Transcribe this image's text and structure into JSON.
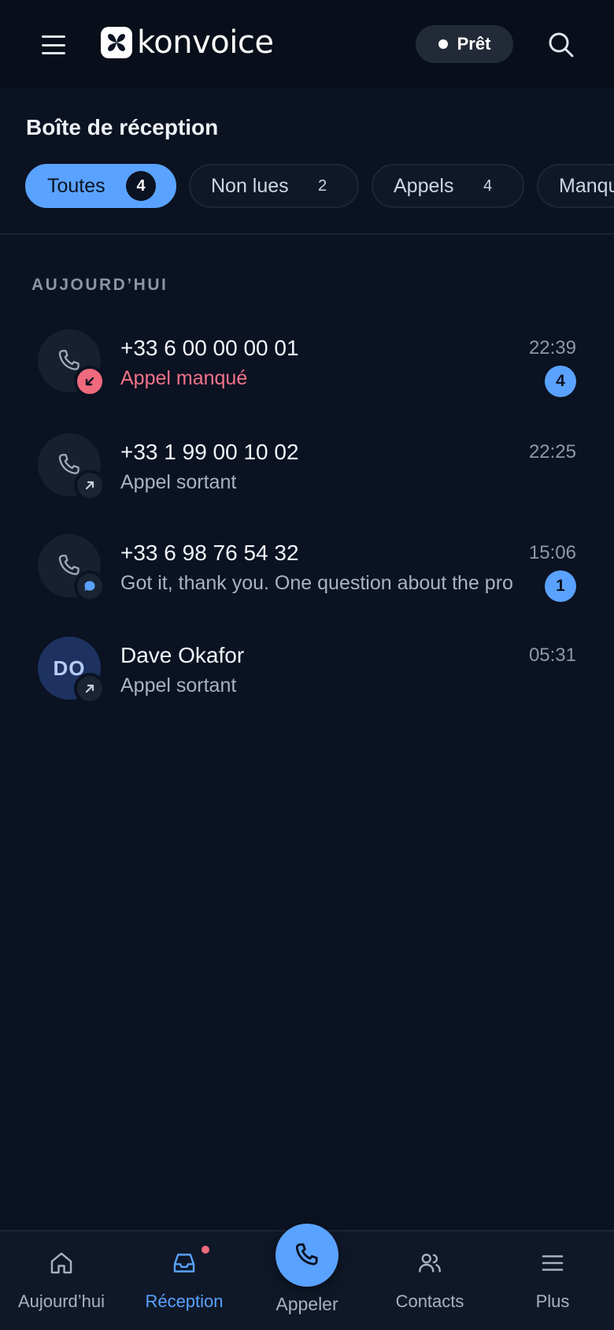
{
  "header": {
    "brand": "konvoice",
    "status_label": "Prêt"
  },
  "inbox": {
    "title": "Boîte de réception",
    "filters": [
      {
        "label": "Toutes",
        "count": "4",
        "active": true
      },
      {
        "label": "Non lues",
        "count": "2",
        "active": false
      },
      {
        "label": "Appels",
        "count": "4",
        "active": false
      },
      {
        "label": "Manqu",
        "count": "",
        "active": false
      }
    ],
    "section_label": "AUJOURD’HUI",
    "conversations": [
      {
        "title": "+33 6 00 00 00 01",
        "subtitle": "Appel manqué",
        "time": "22:39",
        "unread": "4",
        "kind": "missed",
        "avatar": "phone-icon"
      },
      {
        "title": "+33 1 99 00 10 02",
        "subtitle": "Appel sortant",
        "time": "22:25",
        "unread": "",
        "kind": "outgoing",
        "avatar": "phone-icon"
      },
      {
        "title": "+33 6 98 76 54 32",
        "subtitle": "Got it, thank you. One question about the pro",
        "time": "15:06",
        "unread": "1",
        "kind": "message",
        "avatar": "phone-icon"
      },
      {
        "title": "Dave Okafor",
        "subtitle": "Appel sortant",
        "time": "05:31",
        "unread": "",
        "kind": "outgoing",
        "avatar_initials": "DO"
      }
    ]
  },
  "nav": {
    "items": [
      "Aujourd’hui",
      "Réception",
      "Appeler",
      "Contacts",
      "Plus"
    ],
    "active": "Réception"
  },
  "colors": {
    "background": "#0b1221",
    "accent": "#5aa2ff",
    "missed": "#f06a7d"
  }
}
